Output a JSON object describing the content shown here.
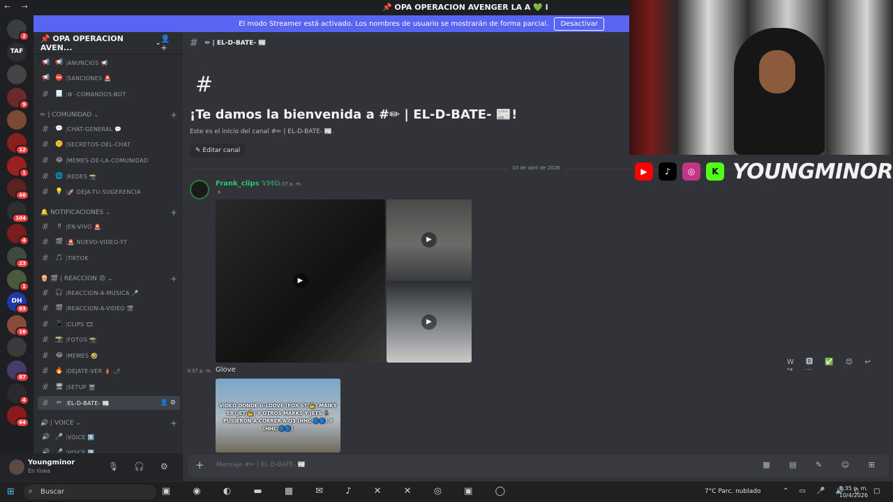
{
  "window": {
    "nav_arrows": "← →",
    "title": "📌 OPA OPERACION AVENGER LA A 💚 l"
  },
  "streamer_banner": {
    "text": "El modo Streamer está activado. Los nombres de usuario se mostrarán de forma parcial.",
    "button": "Desactivar"
  },
  "rail": {
    "servers": [
      {
        "label": "",
        "badge": "2"
      },
      {
        "label": "TAF",
        "badge": ""
      },
      {
        "label": "",
        "badge": ""
      },
      {
        "label": "",
        "badge": "9"
      },
      {
        "label": "",
        "badge": ""
      },
      {
        "label": "",
        "badge": "12"
      },
      {
        "label": "",
        "badge": "1"
      },
      {
        "label": "",
        "badge": "46"
      },
      {
        "label": "",
        "badge": "104"
      },
      {
        "label": "",
        "badge": "4"
      },
      {
        "label": "",
        "badge": "23"
      },
      {
        "label": "",
        "badge": "1"
      },
      {
        "label": "DH",
        "badge": "83"
      },
      {
        "label": "",
        "badge": "16"
      },
      {
        "label": "",
        "badge": ""
      },
      {
        "label": "",
        "badge": "87"
      },
      {
        "label": "",
        "badge": "4"
      },
      {
        "label": "",
        "badge": "64"
      }
    ],
    "new_badge": "NUEVO"
  },
  "sidebar": {
    "server_name": "📌 OPA OPERACION AVEN...",
    "channels": [
      {
        "kind": "ann",
        "emoji": "📢",
        "name": "ANUNCIOS 📢"
      },
      {
        "kind": "ann",
        "emoji": "⛔",
        "name": "SANCIONES 🚨"
      },
      {
        "kind": "text",
        "emoji": "📃",
        "name": "⚙ -COMANDOS-BOT"
      },
      {
        "kind": "cat",
        "name": "✏ | COMUNIDAD ⌄"
      },
      {
        "kind": "text",
        "emoji": "💬",
        "name": "CHAT-GENERAL 💬"
      },
      {
        "kind": "text",
        "emoji": "🤫",
        "name": "SECRETOS-DEL-CHAT"
      },
      {
        "kind": "text",
        "emoji": "😂",
        "name": "MEMES-DE-LA-COMUNIDAD"
      },
      {
        "kind": "text",
        "emoji": "🌐",
        "name": "REDES 📸"
      },
      {
        "kind": "text",
        "emoji": "💡",
        "name": "🚀 DEJA-TU-SUGERENCIA"
      },
      {
        "kind": "cat",
        "name": "🔔 NOTIFICACIONES ⌄"
      },
      {
        "kind": "text",
        "emoji": "‼",
        "name": "EN-VIVO 🚨"
      },
      {
        "kind": "text",
        "emoji": "🎬",
        "name": "🚨 NUEVO-VIDEO-YT"
      },
      {
        "kind": "text",
        "emoji": "🎵",
        "name": "TIKTOK"
      },
      {
        "kind": "cat",
        "name": "🍿 🎬 | REACCION 😡 ⌄"
      },
      {
        "kind": "text",
        "emoji": "🎧",
        "name": "REACCION-A-MUSICA 🎤"
      },
      {
        "kind": "text",
        "emoji": "🎬",
        "name": "REACCION-A-VIDEO 🎬"
      },
      {
        "kind": "text",
        "emoji": "📱",
        "name": "CLIPS 🎞"
      },
      {
        "kind": "text",
        "emoji": "📸",
        "name": "FOTOS 📸"
      },
      {
        "kind": "text",
        "emoji": "😂",
        "name": "MEMES 🤣"
      },
      {
        "kind": "text",
        "emoji": "🔥",
        "name": "DEJATE-VER 🧯 🌶"
      },
      {
        "kind": "text",
        "emoji": "🖥",
        "name": "SETUP 🖥"
      },
      {
        "kind": "sel",
        "emoji": "✏",
        "name": "EL-D-BATE- 📰"
      },
      {
        "kind": "cat",
        "name": "🔊 | VOICE ⌄"
      },
      {
        "kind": "voice",
        "emoji": "🎤",
        "name": "VOICE 1️⃣"
      },
      {
        "kind": "voice",
        "emoji": "🎤",
        "name": "VOICE 2️⃣"
      }
    ]
  },
  "user_panel": {
    "name": "Youngminor",
    "status": "En línea"
  },
  "channel_header": {
    "name": "✏ | EL-D-BATE- 📰"
  },
  "welcome": {
    "hash": "#",
    "title": "¡Te damos la bienvenida a #✏ | EL-D-BATE- 📰!",
    "subtitle": "Este es el inicio del canal #✏ | EL-D-BATE- 📰.",
    "edit_button": "✎ Editar canal"
  },
  "date_divider": "10 de abril de 2026",
  "messages": [
    {
      "author": "Frank_clips 𝕐𝕄ℂ",
      "time": "3:37 p. m.",
      "bolt": "⚡"
    },
    {
      "author": "",
      "time": "3:37 p. m.",
      "text": "Glove",
      "video_caption": "VIDEO DONDE G-LOOVE (FOX ST/💪) MAIKY 59 (JET/💪) Y OTROS MAKKS Y JETS 🏃 PUSIERON A CORRER A Q3 (HHC/🔵🔵) Y (HHC/🔵🔵)"
    }
  ],
  "composer": {
    "placeholder": "Mensaje #✏ | EL-D-BATE- 📰"
  },
  "stream_overlay": {
    "brand": "YOUNGMINOR",
    "youtube_color": "#ff0000",
    "tiktok_color": "#000000",
    "instagram_color": "#c13584",
    "kick_color": "#53fc18"
  },
  "taskbar": {
    "search": "Buscar",
    "weather": "7°C  Parc. nublado",
    "time": "8:35 p. m.",
    "date": "10/4/2026"
  }
}
